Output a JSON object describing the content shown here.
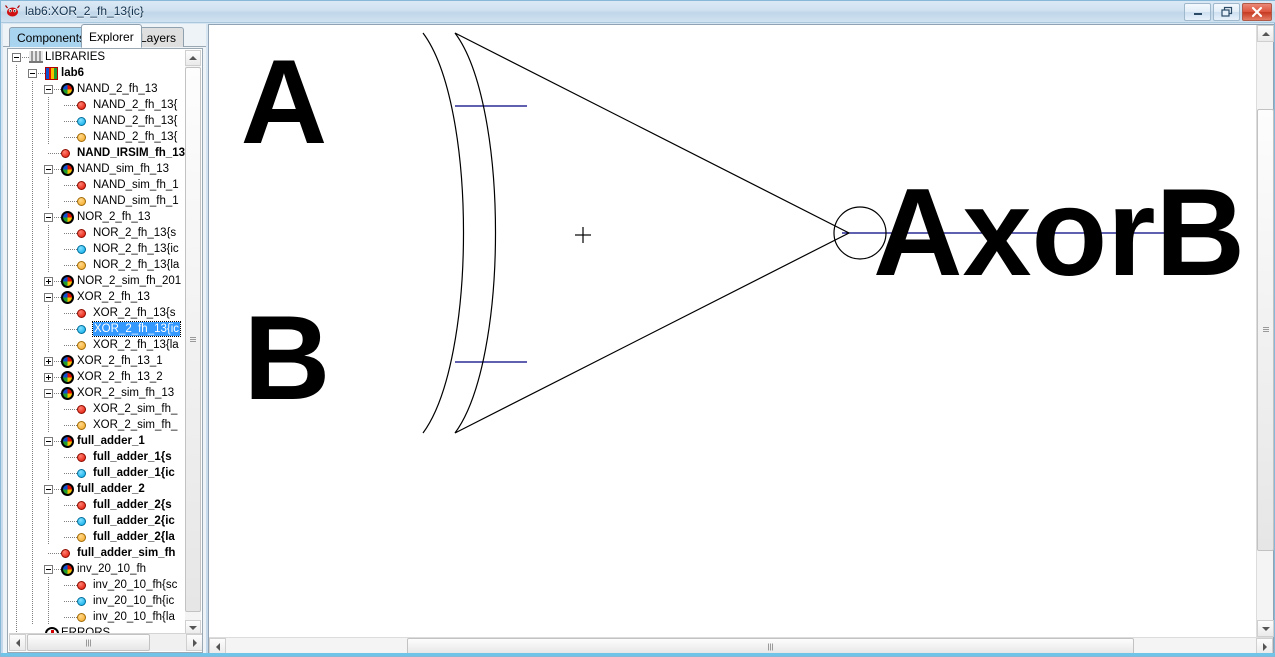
{
  "window": {
    "title": "lab6:XOR_2_fh_13{ic}",
    "app_icon": "electric-logo-icon",
    "minimize_label": "",
    "maximize_label": "",
    "close_label": ""
  },
  "tabs": [
    {
      "label": "Components",
      "state": "inactive-highlighted"
    },
    {
      "label": "Explorer",
      "state": "active"
    },
    {
      "label": "Layers",
      "state": "inactive"
    }
  ],
  "tree": {
    "rows": [
      {
        "label": "LIBRARIES",
        "indent": 0,
        "icon": "library-building-icon",
        "expander": "minus",
        "bold": false,
        "selected": false
      },
      {
        "label": "lab6",
        "indent": 1,
        "icon": "library-book-icon",
        "expander": "minus",
        "bold": true,
        "selected": false
      },
      {
        "label": "NAND_2_fh_13",
        "indent": 2,
        "icon": "cell-group-icon",
        "expander": "minus",
        "bold": false,
        "selected": false
      },
      {
        "label": "NAND_2_fh_13{",
        "indent": 3,
        "icon": "red-dot-icon",
        "expander": "none",
        "bold": false,
        "selected": false
      },
      {
        "label": "NAND_2_fh_13{",
        "indent": 3,
        "icon": "blue-dot-icon",
        "expander": "none",
        "bold": false,
        "selected": false
      },
      {
        "label": "NAND_2_fh_13{",
        "indent": 3,
        "icon": "yellow-dot-icon",
        "expander": "none",
        "bold": false,
        "selected": false
      },
      {
        "label": "NAND_IRSIM_fh_13",
        "indent": 2,
        "icon": "red-dot-icon",
        "expander": "none",
        "bold": true,
        "selected": false
      },
      {
        "label": "NAND_sim_fh_13",
        "indent": 2,
        "icon": "cell-group-icon",
        "expander": "minus",
        "bold": false,
        "selected": false
      },
      {
        "label": "NAND_sim_fh_1",
        "indent": 3,
        "icon": "red-dot-icon",
        "expander": "none",
        "bold": false,
        "selected": false
      },
      {
        "label": "NAND_sim_fh_1",
        "indent": 3,
        "icon": "yellow-dot-icon",
        "expander": "none",
        "bold": false,
        "selected": false
      },
      {
        "label": "NOR_2_fh_13",
        "indent": 2,
        "icon": "cell-group-icon",
        "expander": "minus",
        "bold": false,
        "selected": false
      },
      {
        "label": "NOR_2_fh_13{s",
        "indent": 3,
        "icon": "red-dot-icon",
        "expander": "none",
        "bold": false,
        "selected": false
      },
      {
        "label": "NOR_2_fh_13{ic",
        "indent": 3,
        "icon": "blue-dot-icon",
        "expander": "none",
        "bold": false,
        "selected": false
      },
      {
        "label": "NOR_2_fh_13{la",
        "indent": 3,
        "icon": "yellow-dot-icon",
        "expander": "none",
        "bold": false,
        "selected": false
      },
      {
        "label": "NOR_2_sim_fh_201",
        "indent": 2,
        "icon": "cell-group-icon",
        "expander": "plus",
        "bold": false,
        "selected": false
      },
      {
        "label": "XOR_2_fh_13",
        "indent": 2,
        "icon": "cell-group-icon",
        "expander": "minus",
        "bold": false,
        "selected": false
      },
      {
        "label": "XOR_2_fh_13{s",
        "indent": 3,
        "icon": "red-dot-icon",
        "expander": "none",
        "bold": false,
        "selected": false
      },
      {
        "label": "XOR_2_fh_13{ic",
        "indent": 3,
        "icon": "blue-dot-icon",
        "expander": "none",
        "bold": false,
        "selected": true
      },
      {
        "label": "XOR_2_fh_13{la",
        "indent": 3,
        "icon": "yellow-dot-icon",
        "expander": "none",
        "bold": false,
        "selected": false
      },
      {
        "label": "XOR_2_fh_13_1",
        "indent": 2,
        "icon": "cell-group-icon",
        "expander": "plus",
        "bold": false,
        "selected": false
      },
      {
        "label": "XOR_2_fh_13_2",
        "indent": 2,
        "icon": "cell-group-icon",
        "expander": "plus",
        "bold": false,
        "selected": false
      },
      {
        "label": "XOR_2_sim_fh_13",
        "indent": 2,
        "icon": "cell-group-icon",
        "expander": "minus",
        "bold": false,
        "selected": false
      },
      {
        "label": "XOR_2_sim_fh_",
        "indent": 3,
        "icon": "red-dot-icon",
        "expander": "none",
        "bold": false,
        "selected": false
      },
      {
        "label": "XOR_2_sim_fh_",
        "indent": 3,
        "icon": "yellow-dot-icon",
        "expander": "none",
        "bold": false,
        "selected": false
      },
      {
        "label": "full_adder_1",
        "indent": 2,
        "icon": "cell-group-icon",
        "expander": "minus",
        "bold": true,
        "selected": false
      },
      {
        "label": "full_adder_1{s",
        "indent": 3,
        "icon": "red-dot-icon",
        "expander": "none",
        "bold": true,
        "selected": false
      },
      {
        "label": "full_adder_1{ic",
        "indent": 3,
        "icon": "blue-dot-icon",
        "expander": "none",
        "bold": true,
        "selected": false
      },
      {
        "label": "full_adder_2",
        "indent": 2,
        "icon": "cell-group-icon",
        "expander": "minus",
        "bold": true,
        "selected": false
      },
      {
        "label": "full_adder_2{s",
        "indent": 3,
        "icon": "red-dot-icon",
        "expander": "none",
        "bold": true,
        "selected": false
      },
      {
        "label": "full_adder_2{ic",
        "indent": 3,
        "icon": "blue-dot-icon",
        "expander": "none",
        "bold": true,
        "selected": false
      },
      {
        "label": "full_adder_2{la",
        "indent": 3,
        "icon": "yellow-dot-icon",
        "expander": "none",
        "bold": true,
        "selected": false
      },
      {
        "label": "full_adder_sim_fh",
        "indent": 2,
        "icon": "red-dot-icon",
        "expander": "none",
        "bold": true,
        "selected": false
      },
      {
        "label": "inv_20_10_fh",
        "indent": 2,
        "icon": "cell-group-icon",
        "expander": "minus",
        "bold": false,
        "selected": false
      },
      {
        "label": "inv_20_10_fh{sc",
        "indent": 3,
        "icon": "red-dot-icon",
        "expander": "none",
        "bold": false,
        "selected": false
      },
      {
        "label": "inv_20_10_fh{ic",
        "indent": 3,
        "icon": "blue-dot-icon",
        "expander": "none",
        "bold": false,
        "selected": false
      },
      {
        "label": "inv_20_10_fh{la",
        "indent": 3,
        "icon": "yellow-dot-icon",
        "expander": "none",
        "bold": false,
        "selected": false
      },
      {
        "label": "ERRORS",
        "indent": 1,
        "icon": "errors-icon",
        "expander": "none",
        "bold": false,
        "selected": false
      }
    ]
  },
  "schematic": {
    "gate_type": "xnor-gate",
    "input_labels": [
      "A",
      "B"
    ],
    "output_label": "AxorB",
    "wire_color": "#000080",
    "outline_color": "#000000",
    "cursor_marker": "crosshair-marker"
  },
  "scrollbars": {
    "tree_vertical": "tree-vertical-scrollbar",
    "tree_horizontal": "tree-horizontal-scrollbar",
    "canvas_vertical": "canvas-vertical-scrollbar",
    "canvas_horizontal": "canvas-horizontal-scrollbar"
  }
}
